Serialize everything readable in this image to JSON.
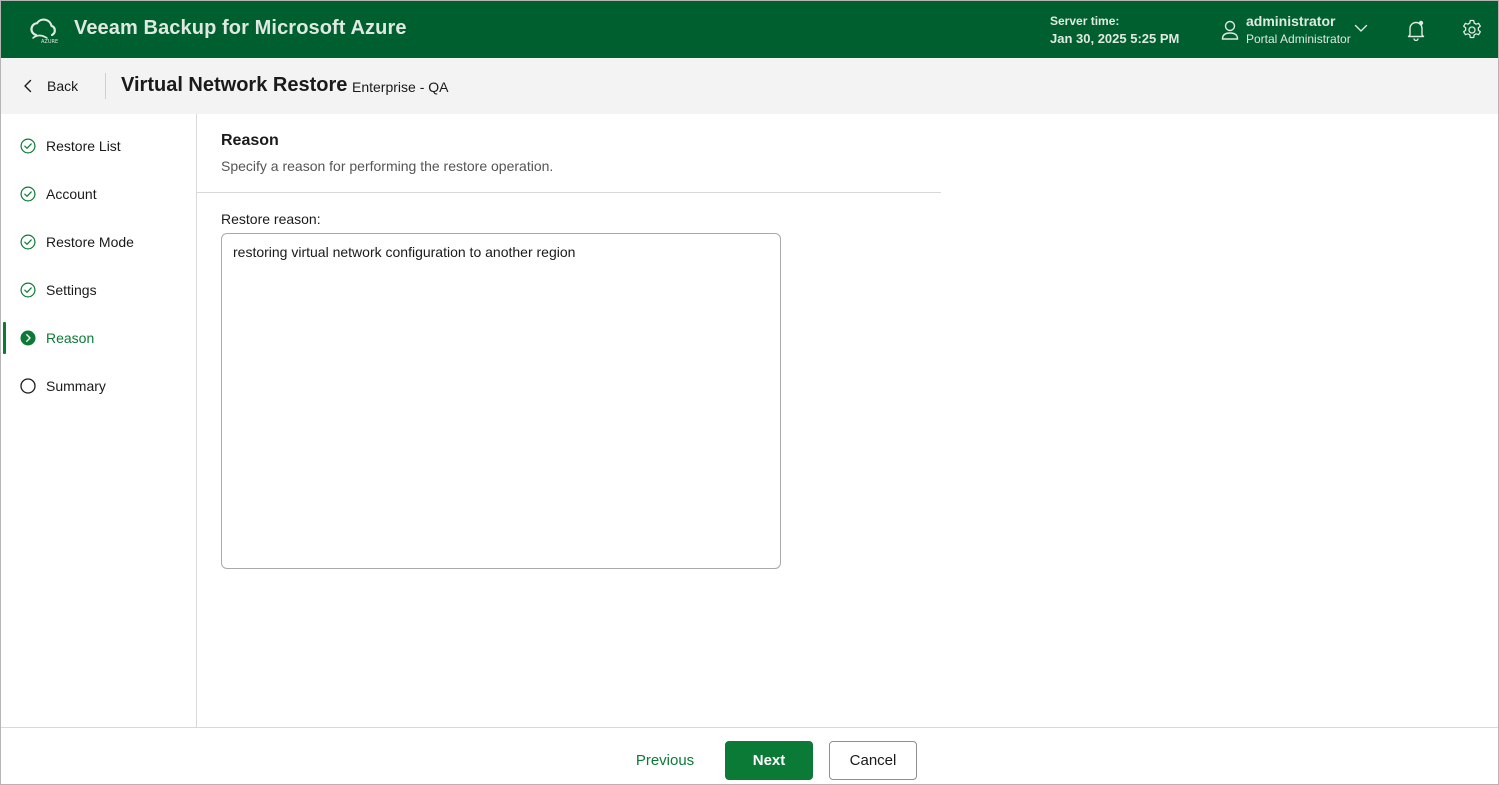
{
  "header": {
    "app_title": "Veeam Backup for Microsoft Azure",
    "logo_label": "AZURE",
    "server_time_label": "Server time:",
    "server_time_value": "Jan 30, 2025 5:25 PM",
    "user_name": "administrator",
    "user_role": "Portal Administrator",
    "icons": [
      "cloud-logo-icon",
      "user-icon",
      "chevron-down-icon",
      "bell-icon",
      "gear-icon"
    ]
  },
  "subheader": {
    "back_label": "Back",
    "title": "Virtual Network Restore",
    "subtitle": "Enterprise - QA"
  },
  "steps": [
    {
      "label": "Restore List",
      "state": "completed"
    },
    {
      "label": "Account",
      "state": "completed"
    },
    {
      "label": "Restore Mode",
      "state": "completed"
    },
    {
      "label": "Settings",
      "state": "completed"
    },
    {
      "label": "Reason",
      "state": "active"
    },
    {
      "label": "Summary",
      "state": "pending"
    }
  ],
  "main": {
    "section_title": "Reason",
    "section_description": "Specify a reason for performing the restore operation.",
    "field_label": "Restore reason:",
    "reason_value": "restoring virtual network configuration to another region"
  },
  "footer": {
    "previous_label": "Previous",
    "next_label": "Next",
    "cancel_label": "Cancel"
  },
  "colors": {
    "header_bg": "#005f2e",
    "accent": "#0b7a37",
    "subheader_bg": "#f2f3f2"
  }
}
